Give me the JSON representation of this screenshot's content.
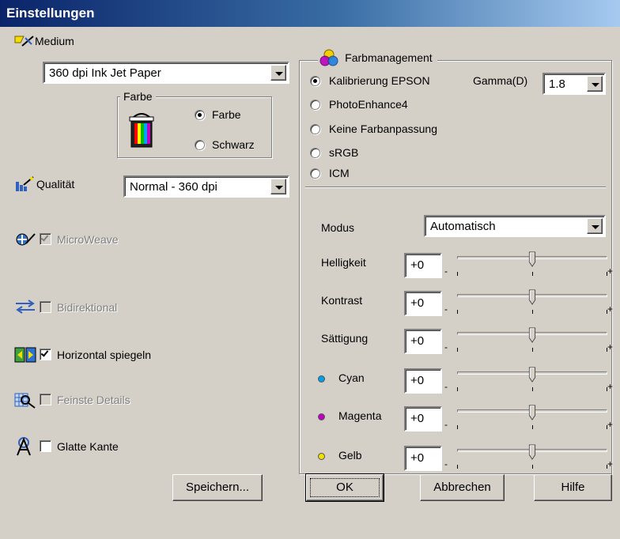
{
  "window": {
    "title": "Einstellungen"
  },
  "medium": {
    "label": "Medium",
    "value": "360 dpi Ink Jet Paper"
  },
  "farbe_group": {
    "legend": "Farbe",
    "options": [
      {
        "label": "Farbe",
        "selected": true
      },
      {
        "label": "Schwarz",
        "selected": false
      }
    ]
  },
  "qualitaet": {
    "label": "Qualität",
    "value": "Normal - 360 dpi"
  },
  "checkboxes": [
    {
      "label": "MicroWeave",
      "checked": true,
      "enabled": false
    },
    {
      "label": "Bidirektional",
      "checked": false,
      "enabled": false
    },
    {
      "label": "Horizontal spiegeln",
      "checked": true,
      "enabled": true
    },
    {
      "label": "Feinste Details",
      "checked": false,
      "enabled": false
    },
    {
      "label": "Glatte Kante",
      "checked": false,
      "enabled": true
    }
  ],
  "farbmanagement": {
    "legend": "Farbmanagement",
    "options": [
      {
        "label": "Kalibrierung EPSON",
        "selected": true
      },
      {
        "label": "PhotoEnhance4",
        "selected": false
      },
      {
        "label": "Keine Farbanpassung",
        "selected": false
      },
      {
        "label": "sRGB",
        "selected": false
      },
      {
        "label": "ICM",
        "selected": false
      }
    ],
    "gamma": {
      "label": "Gamma(D)",
      "value": "1.8"
    },
    "modus": {
      "label": "Modus",
      "value": "Automatisch"
    },
    "sliders": [
      {
        "label": "Helligkeit",
        "value": "+0",
        "level": 0
      },
      {
        "label": "Kontrast",
        "value": "+0",
        "level": 0
      },
      {
        "label": "Sättigung",
        "value": "+0",
        "level": 0
      },
      {
        "label": "Cyan",
        "value": "+0",
        "level": 0,
        "color": "#00a0e8"
      },
      {
        "label": "Magenta",
        "value": "+0",
        "level": 0,
        "color": "#c000c0"
      },
      {
        "label": "Gelb",
        "value": "+0",
        "level": 0,
        "color": "#f0e000"
      }
    ],
    "minus": "-",
    "plus": "+"
  },
  "buttons": {
    "save": "Speichern...",
    "ok": "OK",
    "cancel": "Abbrechen",
    "help": "Hilfe"
  }
}
